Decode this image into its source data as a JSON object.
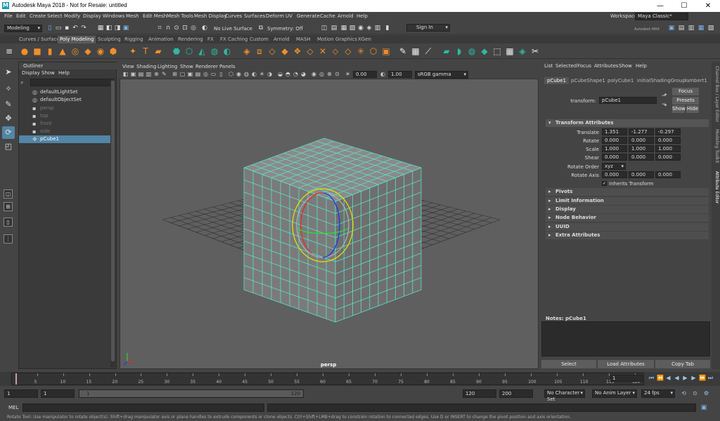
{
  "window": {
    "title": "Autodesk Maya 2018 - Not for Resale: untitled",
    "app_icon": "M",
    "minimize": "—",
    "maximize": "☐",
    "close": "✕"
  },
  "menu": {
    "items": [
      "File",
      "Edit",
      "Create",
      "Select",
      "Modify",
      "Display",
      "Windows",
      "Mesh",
      "Edit Mesh",
      "Mesh Tools",
      "Mesh Display",
      "Curves",
      "Surfaces",
      "Deform",
      "UV",
      "Generate",
      "Cache",
      "Arnold",
      "Help"
    ],
    "workspace_label": "Workspace :",
    "workspace_value": "Maya Classic*"
  },
  "status_line": {
    "menuset": "Modeling",
    "live_surface": "No Live Surface",
    "symmetry": "Symmetry: Off",
    "sign_in": "Sign In",
    "autodesk": "Autodesk MAX"
  },
  "shelf": {
    "tabs": [
      "Curves / Surfaces",
      "Poly Modeling",
      "Sculpting",
      "Rigging",
      "Animation",
      "Rendering",
      "FX",
      "FX Caching",
      "Custom",
      "Arnold",
      "MASH",
      "Motion Graphics",
      "XGen"
    ],
    "active_tab": "Poly Modeling",
    "text_icon": "T"
  },
  "outliner": {
    "title": "Outliner",
    "menus": [
      "Display",
      "Show",
      "Help"
    ],
    "items": [
      {
        "label": "defaultLightSet",
        "icon": "◎",
        "style": "normal"
      },
      {
        "label": "defaultObjectSet",
        "icon": "◎",
        "style": "normal"
      },
      {
        "label": "persp",
        "icon": "▪",
        "style": "dim"
      },
      {
        "label": "top",
        "icon": "▪",
        "style": "dim"
      },
      {
        "label": "front",
        "icon": "▪",
        "style": "dim"
      },
      {
        "label": "side",
        "icon": "▪",
        "style": "dim"
      },
      {
        "label": "pCube1",
        "icon": "✥",
        "style": "selected"
      }
    ]
  },
  "viewport": {
    "menus": [
      "View",
      "Shading",
      "Lighting",
      "Show",
      "Renderer",
      "Panels"
    ],
    "exposure": "0.00",
    "gamma": "1.00",
    "color_space": "sRGB gamma",
    "camera_label": "persp",
    "mesh_color": "#5ee0c4"
  },
  "attribute_editor": {
    "menus": [
      "List",
      "Selected",
      "Focus",
      "Attributes",
      "Show",
      "Help"
    ],
    "tabs": [
      "pCube1",
      "pCubeShape1",
      "polyCube1",
      "initialShadingGroup",
      "lambert1"
    ],
    "transform_label": "transform:",
    "transform_value": "pCube1",
    "focus_btn": "Focus",
    "presets_btn": "Presets",
    "show_btn": "Show",
    "hide_btn": "Hide",
    "section_transform": "Transform Attributes",
    "rows": [
      {
        "label": "Translate",
        "values": [
          "1.351",
          "-1.277",
          "-0.297"
        ]
      },
      {
        "label": "Rotate",
        "values": [
          "0.000",
          "0.000",
          "0.000"
        ]
      },
      {
        "label": "Scale",
        "values": [
          "1.000",
          "1.000",
          "1.000"
        ]
      },
      {
        "label": "Shear",
        "values": [
          "0.000",
          "0.000",
          "0.000"
        ]
      }
    ],
    "rotate_order_label": "Rotate Order",
    "rotate_order_value": "xyz",
    "rotate_axis_label": "Rotate Axis",
    "rotate_axis_values": [
      "0.000",
      "0.000",
      "0.000"
    ],
    "inherits_label": "Inherits Transform",
    "sections": [
      "Pivots",
      "Limit Information",
      "Display",
      "Node Behavior",
      "UUID",
      "Extra Attributes"
    ],
    "notes_label": "Notes: pCube1",
    "select_btn": "Select",
    "load_btn": "Load Attributes",
    "copy_btn": "Copy Tab"
  },
  "side_tabs": [
    "Channel Box / Layer Editor",
    "Modeling Toolkit",
    "Attribute Editor"
  ],
  "time_slider": {
    "ticks": [
      "5",
      "10",
      "15",
      "20",
      "25",
      "30",
      "35",
      "40",
      "45",
      "50",
      "55",
      "60",
      "65",
      "70",
      "75",
      "80",
      "85",
      "90",
      "95",
      "100",
      "105",
      "110",
      "115",
      "120"
    ],
    "current_frame": "1"
  },
  "range_slider": {
    "start": "1",
    "playback_start": "1",
    "range_left": "1",
    "range_right": "120",
    "playback_end": "120",
    "end": "200",
    "character_set": "No Character Set",
    "anim_layer": "No Anim Layer",
    "fps": "24 fps"
  },
  "command_line": {
    "label": "MEL"
  },
  "help_line": "Rotate Tool: Use manipulator to rotate object(s). Shift+drag manipulator axis or plane handles to extrude components or clone objects. Ctrl+Shift+LMB+drag to constrain rotation to connected edges. Use D or INSERT to change the pivot position and axis orientation."
}
